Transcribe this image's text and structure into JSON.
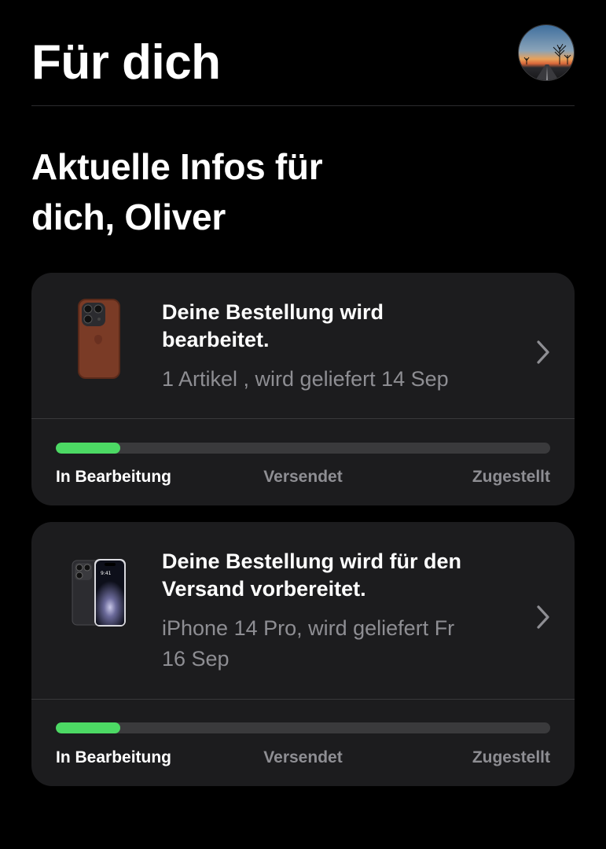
{
  "header": {
    "title": "Für dich",
    "avatar_icon": "profile-photo-avatar"
  },
  "greeting": {
    "line1": "Aktuelle Infos für",
    "line2": "dich, Oliver"
  },
  "orders": [
    {
      "status_title_line1": "Deine Bestellung wird",
      "status_title_line2": "bearbeitet.",
      "subtitle_line1": "1 Artikel , wird geliefert 14 Sep",
      "subtitle_line2": "",
      "thumbnail_icon": "leather-case-thumbnail",
      "chevron_icon": "chevron-right-icon",
      "progress": 0.13,
      "steps": [
        "In Bearbeitung",
        "Versendet",
        "Zugestellt"
      ],
      "active_step": 0
    },
    {
      "status_title_line1": "Deine Bestellung wird für den",
      "status_title_line2": "Versand vorbereitet.",
      "subtitle_line1": "iPhone 14 Pro, wird geliefert Fr",
      "subtitle_line2": "16 Sep",
      "thumbnail_icon": "iphone-14-pro-thumbnail",
      "chevron_icon": "chevron-right-icon",
      "progress": 0.13,
      "steps": [
        "In Bearbeitung",
        "Versendet",
        "Zugestellt"
      ],
      "active_step": 0
    }
  ],
  "colors": {
    "background": "#000000",
    "card": "#1c1c1e",
    "progress_fill": "#4cd964",
    "progress_track": "#3a3a3c",
    "secondary_text": "#8e8e93"
  }
}
